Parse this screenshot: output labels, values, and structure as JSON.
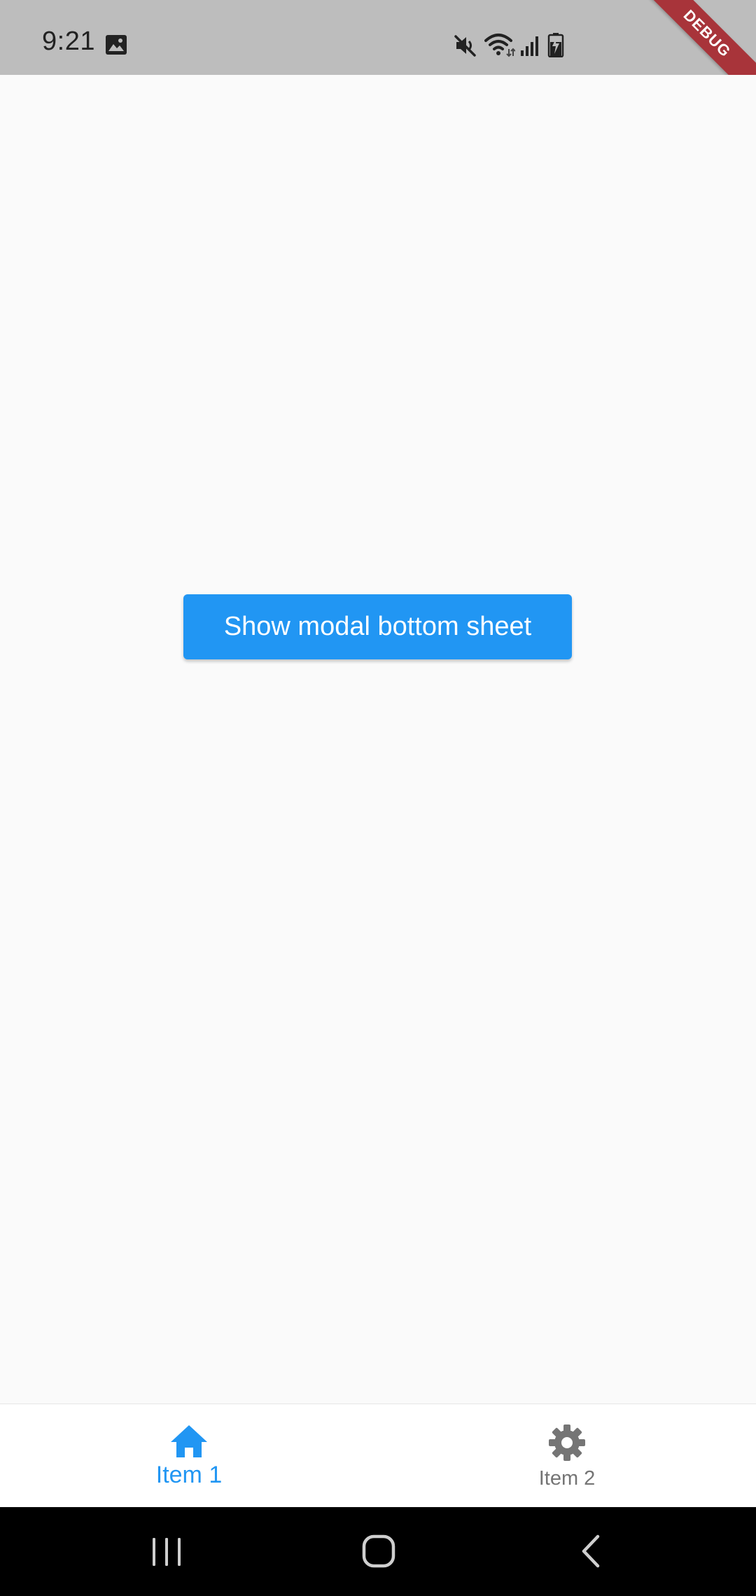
{
  "status_bar": {
    "time": "9:21",
    "icons": [
      "image-icon",
      "mute-icon",
      "wifi-icon",
      "signal-icon",
      "battery-icon"
    ],
    "background_color": "#bdbdbd"
  },
  "debug_banner": {
    "label": "DEBUG",
    "color": "#a8343a"
  },
  "main": {
    "button_label": "Show modal bottom sheet",
    "button_color": "#2196f3"
  },
  "bottom_nav": {
    "items": [
      {
        "label": "Item 1",
        "icon": "home-icon",
        "selected": true,
        "color": "#2196f3"
      },
      {
        "label": "Item 2",
        "icon": "settings-icon",
        "selected": false,
        "color": "#757575"
      }
    ]
  },
  "system_nav": {
    "buttons": [
      "recents-icon",
      "home-button-icon",
      "back-icon"
    ]
  }
}
